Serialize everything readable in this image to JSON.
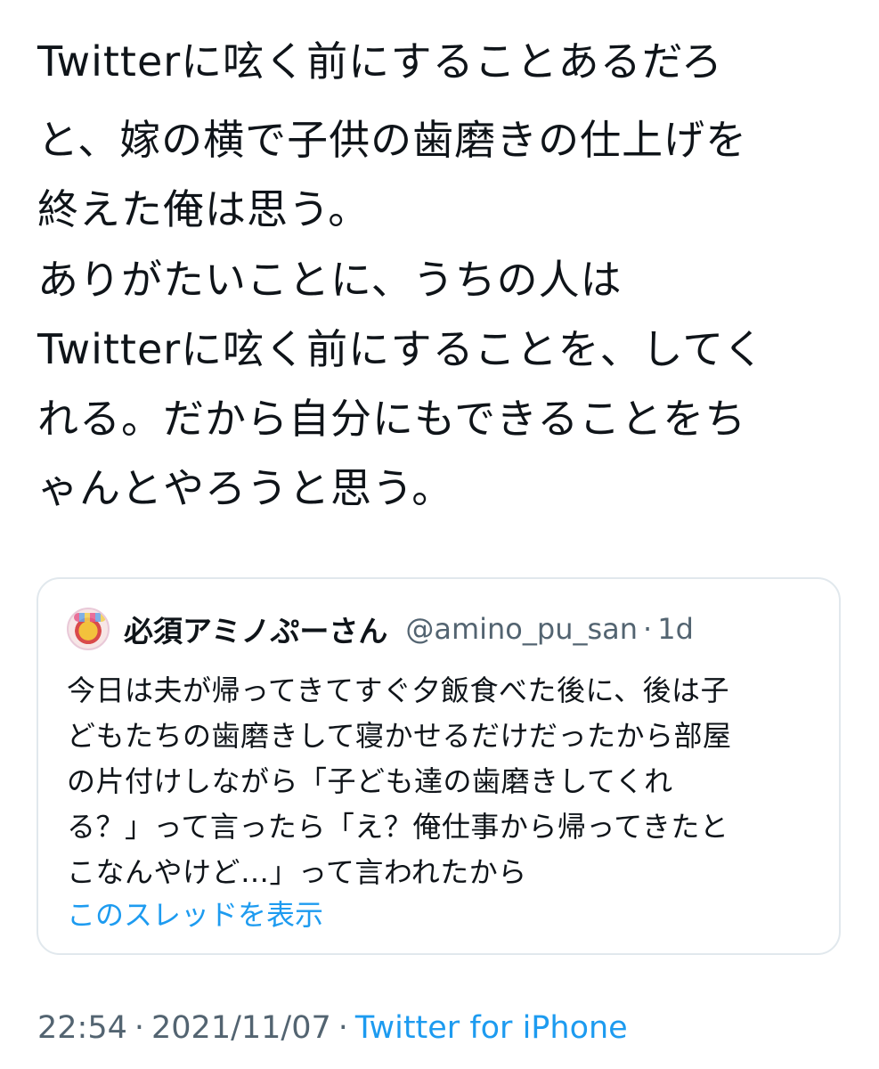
{
  "tweet": {
    "lines": [
      "Twitterに呟く前にすることあるだろ",
      "と、嫁の横で子供の歯磨きの仕上げを",
      "終えた俺は思う。",
      "ありがたいことに、うちの人は",
      "Twitterに呟く前にすることを、してく",
      "れる。だから自分にもできることをち",
      "ゃんとやろうと思う。"
    ]
  },
  "quote": {
    "display_name": "必須アミノぷーさん",
    "handle": "@amino_pu_san",
    "separator": "·",
    "age": "1d",
    "lines": [
      "今日は夫が帰ってきてすぐ夕飯食べた後に、後は子",
      "どもたちの歯磨きして寝かせるだけだったから部屋",
      "の片付けしながら「子ども達の歯磨きしてくれ",
      "る？」って言ったら「え？俺仕事から帰ってきたと",
      "こなんやけど…」って言われたから"
    ],
    "show_thread_label": "このスレッドを表示"
  },
  "meta": {
    "time": "22:54",
    "separator": "·",
    "date": "2021/11/07",
    "source": "Twitter for iPhone"
  },
  "colors": {
    "text": "#0f1419",
    "secondary": "#536471",
    "link": "#1d9bf0",
    "border": "#e1e8ed"
  }
}
